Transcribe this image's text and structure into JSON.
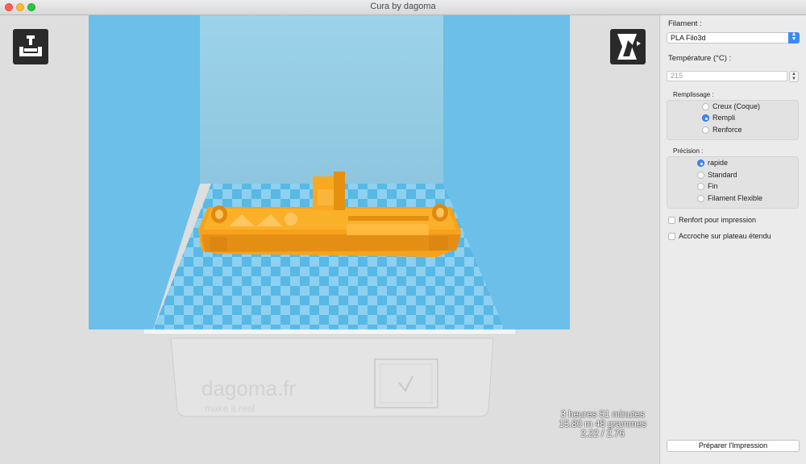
{
  "window": {
    "title": "Cura by dagoma"
  },
  "viewport": {
    "printer_brand": "dagoma.fr",
    "printer_slogan": "make it real",
    "stats": {
      "time": "3 heures 51 minutes",
      "material": "15.80 m 48 grammes",
      "cost": "2.22 / 2.76"
    },
    "icons": {
      "load": "load-model-icon",
      "view": "view-mode-icon"
    }
  },
  "panel": {
    "filament_label": "Filament :",
    "filament_value": "PLA Filo3d",
    "temperature_label": "Température (°C) :",
    "temperature_placeholder": "215",
    "fill_label": "Remplissage :",
    "fill_options": [
      "Creux (Coque)",
      "Rempli",
      "Renforce"
    ],
    "fill_selected": "Rempli",
    "precision_label": "Précision :",
    "precision_options": [
      "rapide",
      "Standard",
      "Fin",
      "Filament Flexible"
    ],
    "precision_selected": "rapide",
    "support_label": "Renfort pour impression",
    "brim_label": "Accroche sur plateau étendu",
    "prepare_button": "Préparer l'Impression"
  },
  "colors": {
    "model": "#f7a21b",
    "bed_blue": "#6cc3ea",
    "volume_blue": "#5ab2dd",
    "accent": "#3b8af6"
  }
}
